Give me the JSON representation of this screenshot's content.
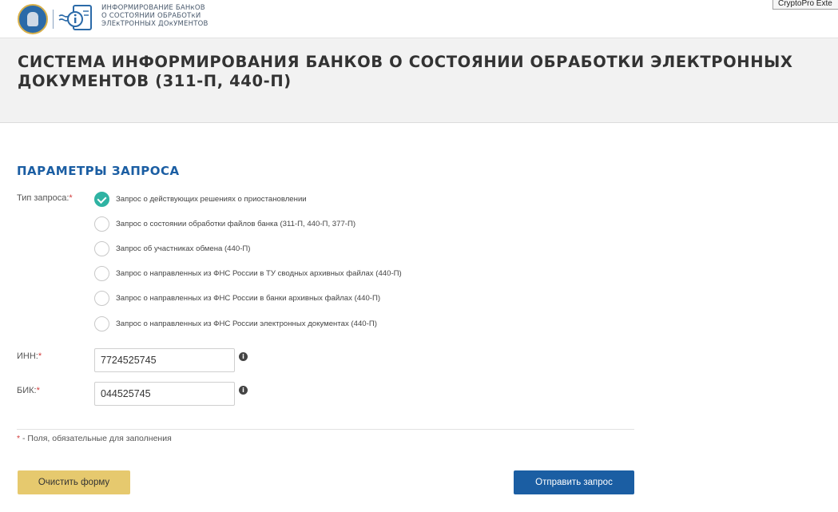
{
  "header": {
    "logo_lines": [
      "ИНФОРМИРОВАНИЕ БАНкОВ",
      "О СОСТОЯНИИ ОБРАБОТкИ",
      "ЭЛЕкТРОННЫХ ДОкУМЕНТОВ"
    ],
    "extension_tab": "CryptoPro Exte"
  },
  "page": {
    "title": "СИСТЕМА ИНФОРМИРОВАНИЯ БАНКОВ О СОСТОЯНИИ ОБРАБОТКИ ЭЛЕКТРОННЫХ ДОКУМЕНТОВ (311-П, 440-П)"
  },
  "form": {
    "section_title": "ПАРАМЕТРЫ ЗАПРОСА",
    "request_type_label": "Тип запроса:",
    "required_mark": "*",
    "request_types": [
      {
        "label": "Запрос о действующих решениях о приостановлении",
        "checked": true
      },
      {
        "label": "Запрос о состоянии обработки файлов банка (311-П, 440-П, 377-П)",
        "checked": false
      },
      {
        "label": "Запрос об участниках обмена (440-П)",
        "checked": false
      },
      {
        "label": "Запрос о направленных из ФНС России в ТУ сводных архивных файлах (440-П)",
        "checked": false
      },
      {
        "label": "Запрос о направленных из ФНС России в банки архивных файлах (440-П)",
        "checked": false
      },
      {
        "label": "Запрос о направленных из ФНС России электронных документах (440-П)",
        "checked": false
      }
    ],
    "inn_label": "ИНН:",
    "inn_value": "7724525745",
    "bik_label": "БИК:",
    "bik_value": "044525745",
    "info_glyph": "i",
    "required_note": " - Поля, обязательные для заполнения",
    "clear_button": "Очистить форму",
    "submit_button": "Отправить запрос"
  },
  "colors": {
    "accent_blue": "#1b5ea3",
    "checked_teal": "#2fb3a3",
    "clear_button_yellow": "#e6c96e",
    "required_red": "#d23c3c"
  }
}
